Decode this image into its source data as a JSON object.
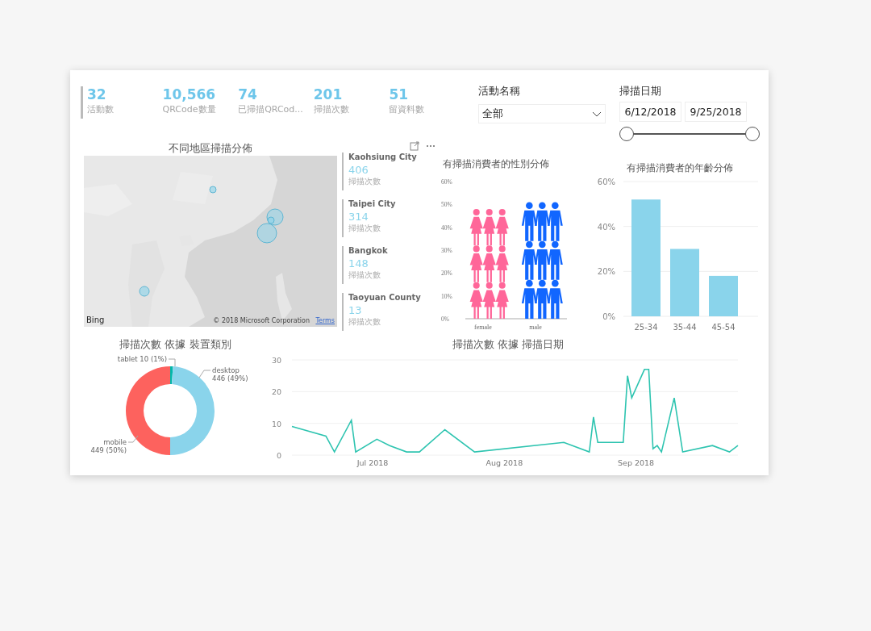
{
  "kpis": [
    {
      "value": "32",
      "label": "活動數"
    },
    {
      "value": "10,566",
      "label": "QRCode數量"
    },
    {
      "value": "74",
      "label": "已掃描QRCod..."
    },
    {
      "value": "201",
      "label": "掃描次數"
    },
    {
      "value": "51",
      "label": "留資料數"
    }
  ],
  "activity_filter": {
    "label": "活動名稱",
    "value": "全部"
  },
  "date_filter": {
    "label": "掃描日期",
    "start": "6/12/2018",
    "end": "9/25/2018",
    "start_handle": {
      "level": 0
    },
    "end_handle": {
      "level": 1
    }
  },
  "map": {
    "title": "不同地區掃描分佈",
    "logo": "Bing",
    "copyright": "© 2018 Microsoft Corporation",
    "terms": "Terms"
  },
  "locations": [
    {
      "name": "Kaohsiung City",
      "value": "406",
      "label": "掃描次數"
    },
    {
      "name": "Taipei City",
      "value": "314",
      "label": "掃描次數"
    },
    {
      "name": "Bangkok",
      "value": "148",
      "label": "掃描次數"
    },
    {
      "name": "Taoyuan County",
      "value": "13",
      "label": "掃描次數"
    }
  ],
  "gender": {
    "title": "有掃描消費者的性別分佈",
    "axis_labels": [
      "60%",
      "50%",
      "40%",
      "30%",
      "20%",
      "10%",
      "0%"
    ],
    "groups": [
      {
        "label": "female",
        "kind": "female",
        "color": "#ff6699",
        "level": 0.8
      },
      {
        "label": "male",
        "kind": "male",
        "color": "#1166ff",
        "level": 0.85
      }
    ]
  },
  "age": {
    "chart_data": {
      "type": "bar",
      "title": "有掃描消費者的年齡分佈",
      "categories": [
        "25-34",
        "35-44",
        "45-54"
      ],
      "series": [
        {
          "color": "#8ad4eb",
          "values": [
            52,
            30,
            18
          ]
        }
      ],
      "ylim": [
        0,
        60
      ],
      "yticks": [
        {
          "value": 0,
          "label": "0%"
        },
        {
          "value": 20,
          "label": "20%"
        },
        {
          "value": 40,
          "label": "40%"
        },
        {
          "value": 60,
          "label": "60%"
        }
      ]
    }
  },
  "device": {
    "chart_data": {
      "type": "donut",
      "title": "掃描次數 依據 裝置類別",
      "categories": [
        "tablet",
        "desktop",
        "mobile"
      ],
      "series": [
        {
          "values": [
            1,
            49,
            50
          ],
          "colors": [
            "#01b8aa",
            "#8ad4eb",
            "#fd625e"
          ]
        }
      ],
      "value_labels": [
        "10 (1%)",
        "446 (49%)",
        "449 (50%)"
      ]
    }
  },
  "trend": {
    "chart_data": {
      "type": "line",
      "title": "掃描次數 依據 掃描日期",
      "x": [
        "2018-06-12",
        "2018-06-20",
        "2018-06-22",
        "2018-06-26",
        "2018-06-27",
        "2018-07-02",
        "2018-07-05",
        "2018-07-09",
        "2018-07-12",
        "2018-07-18",
        "2018-07-25",
        "2018-08-15",
        "2018-08-21",
        "2018-08-22",
        "2018-08-23",
        "2018-08-29",
        "2018-08-30",
        "2018-08-31",
        "2018-09-03",
        "2018-09-04",
        "2018-09-05",
        "2018-09-06",
        "2018-09-07",
        "2018-09-10",
        "2018-09-12",
        "2018-09-19",
        "2018-09-23",
        "2018-09-25"
      ],
      "series": [
        {
          "color": "#2ec4b0",
          "values": [
            9,
            6,
            1,
            11,
            1,
            5,
            3,
            1,
            1,
            8,
            1,
            4,
            1,
            12,
            4,
            4,
            25,
            18,
            27,
            27,
            2,
            3,
            1,
            18,
            1,
            3,
            1,
            3
          ]
        }
      ],
      "xlim": [
        "2018-06-12",
        "2018-09-25"
      ],
      "ylim": [
        0,
        30
      ],
      "yticks": [
        0,
        10,
        20,
        30
      ],
      "xticks": [
        {
          "value": "2018-07-01",
          "label": "Jul 2018"
        },
        {
          "value": "2018-08-01",
          "label": "Aug 2018"
        },
        {
          "value": "2018-09-01",
          "label": "Sep 2018"
        }
      ]
    }
  }
}
